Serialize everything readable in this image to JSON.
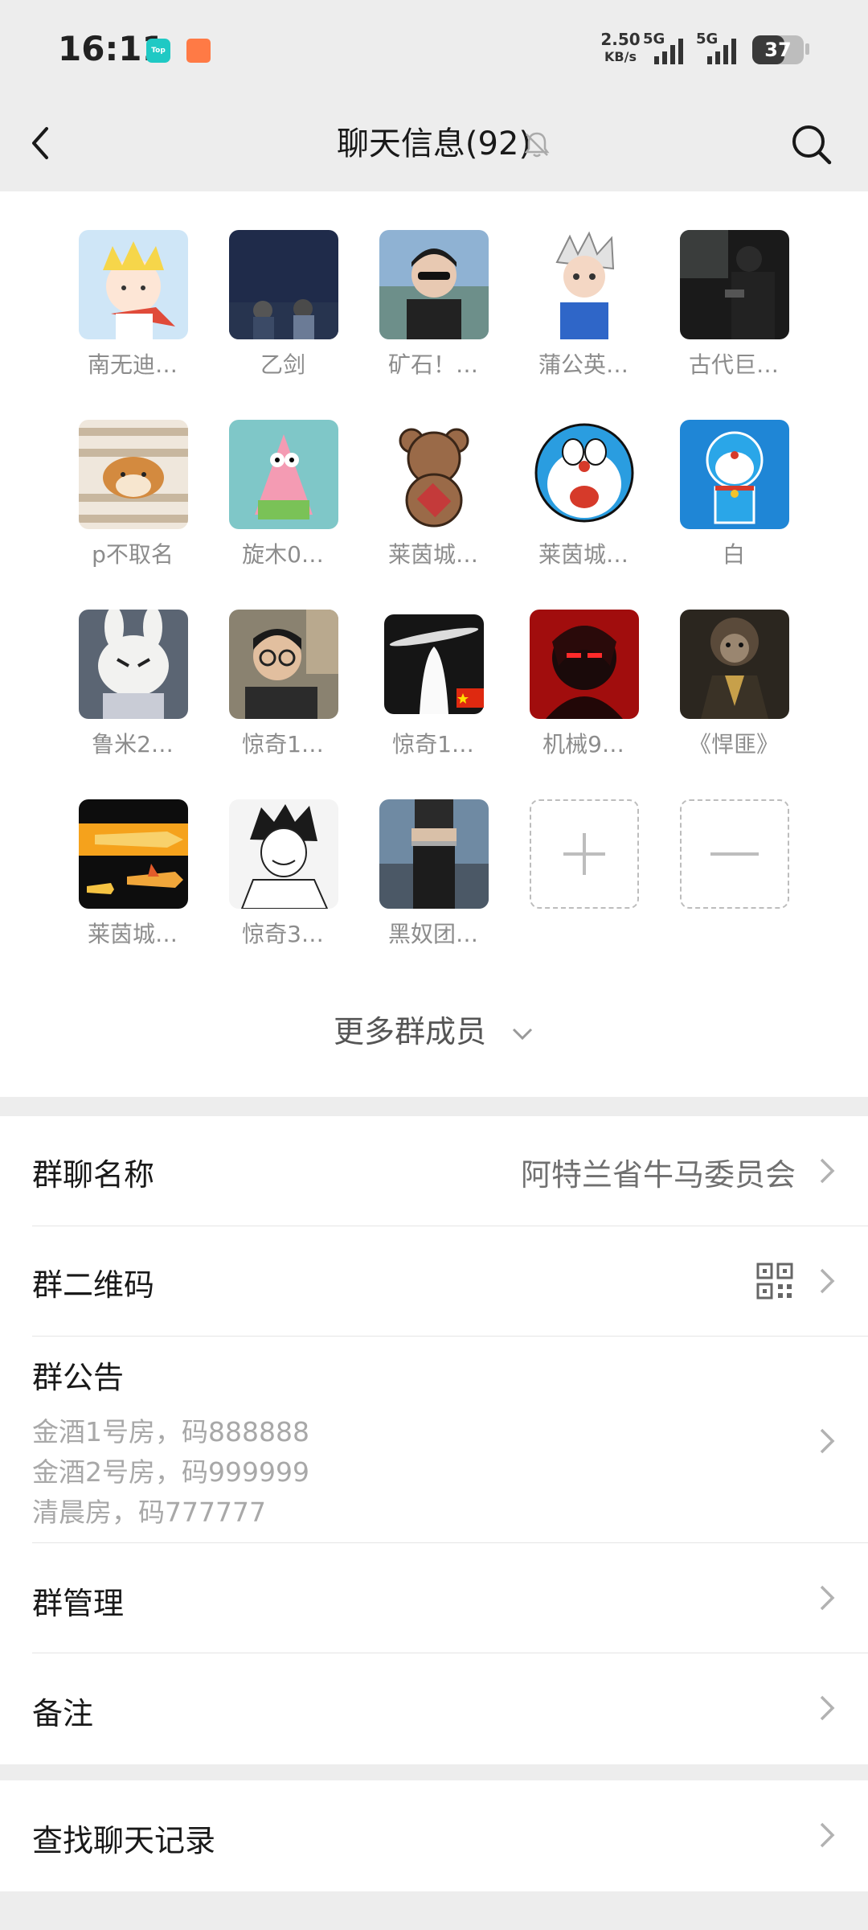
{
  "status_bar": {
    "time": "16:11",
    "app_icon_1": "Top",
    "speed_value": "2.50",
    "speed_unit": "KB/s",
    "network_1": "5G",
    "network_2": "5G",
    "battery": "37"
  },
  "header": {
    "title": "聊天信息(92)",
    "icons": [
      "back-icon",
      "mute-bell-icon",
      "search-icon"
    ]
  },
  "members": [
    {
      "name": "南无迪…",
      "avatar": "little-prince-cartoon"
    },
    {
      "name": "乙剑",
      "avatar": "night-couple-photo"
    },
    {
      "name": "矿石！…",
      "avatar": "man-sunglasses-photo"
    },
    {
      "name": "蒲公英…",
      "avatar": "anime-boy"
    },
    {
      "name": "古代巨…",
      "avatar": "car-interior-photo"
    },
    {
      "name": "p不取名",
      "avatar": "shiba-dog"
    },
    {
      "name": "旋木0…",
      "avatar": "patrick-star"
    },
    {
      "name": "莱茵城…",
      "avatar": "brown-teddy-bear"
    },
    {
      "name": "莱茵城…",
      "avatar": "doraemon-face"
    },
    {
      "name": "白",
      "avatar": "doraemon-blue"
    },
    {
      "name": "鲁米2…",
      "avatar": "white-rabbit"
    },
    {
      "name": "惊奇1…",
      "avatar": "boy-glasses-photo"
    },
    {
      "name": "惊奇1…",
      "avatar": "galaxy-silhouette"
    },
    {
      "name": "机械9…",
      "avatar": "red-dark-anime"
    },
    {
      "name": "《悍匪》",
      "avatar": "monkey-king"
    },
    {
      "name": "莱茵城…",
      "avatar": "planes-cartoon"
    },
    {
      "name": "惊奇3…",
      "avatar": "manga-sketch"
    },
    {
      "name": "黑奴团…",
      "avatar": "woman-outdoor-photo"
    }
  ],
  "member_actions": {
    "add": "plus-icon",
    "remove": "minus-icon"
  },
  "more_members": "更多群成员",
  "settings": {
    "group_name_label": "群聊名称",
    "group_name_value": "阿特兰省牛马委员会",
    "qr_label": "群二维码",
    "notice_label": "群公告",
    "notice_lines": [
      "金酒1号房，码888888",
      "金酒2号房，码999999",
      "清晨房，码777777"
    ],
    "manage_label": "群管理",
    "remark_label": "备注",
    "search_history_label": "查找聊天记录"
  }
}
